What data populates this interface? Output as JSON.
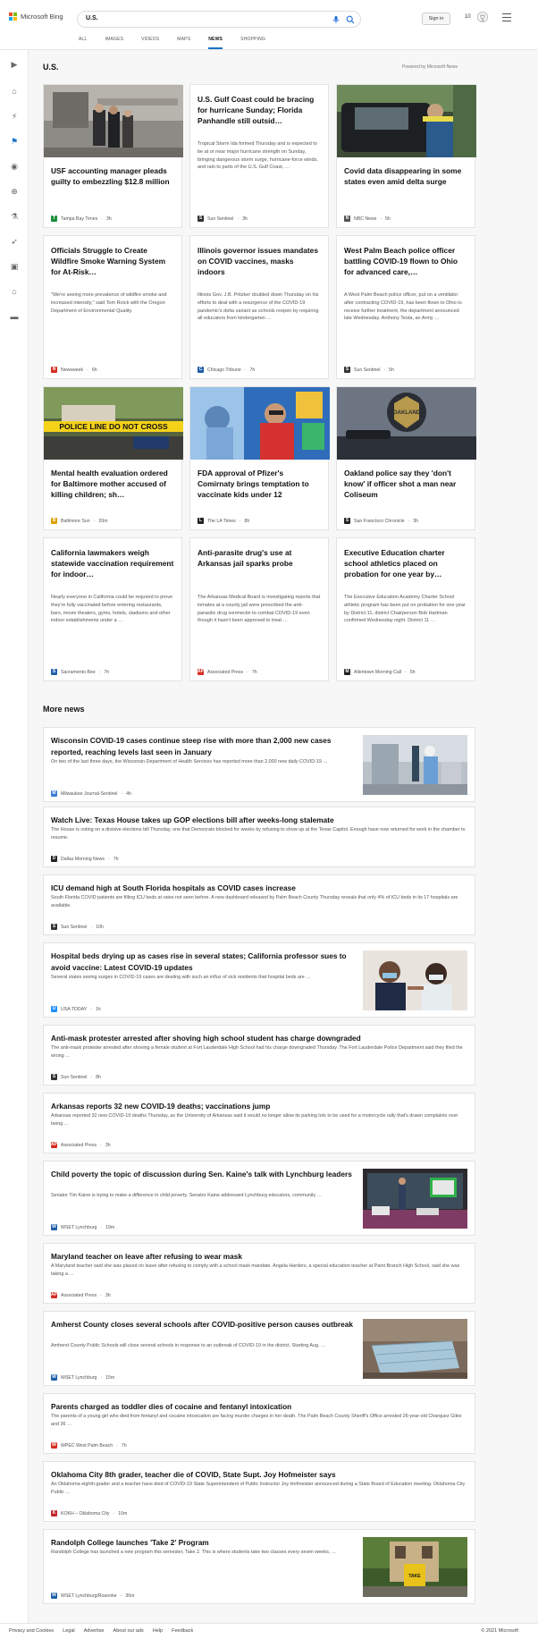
{
  "header": {
    "logo_text": "Microsoft Bing",
    "search_value": "U.S.",
    "sign_in": "Sign in",
    "points": "10",
    "tabs": [
      "ALL",
      "IMAGES",
      "VIDEOS",
      "MAPS",
      "NEWS",
      "SHOPPING"
    ],
    "active_tab": "NEWS"
  },
  "section": {
    "title": "U.S.",
    "powered_by": "Powered by Microsoft News"
  },
  "top_cards": [
    {
      "title": "USF accounting manager pleads guilty to embezzling $12.8 million",
      "snippet": "",
      "source": "Tampa Bay Times",
      "time": "3h",
      "badge": "T",
      "badge_color": "#1a8f3a",
      "has_image": true
    },
    {
      "title": "U.S. Gulf Coast could be bracing for hurricane Sunday; Florida Panhandle still outsid…",
      "snippet": "Tropical Storm Ida formed Thursday and is expected to be at or near major hurricane strength on Sunday, bringing dangerous storm surge, hurricane-force winds, and rain to parts of the U.S. Gulf Coast, …",
      "source": "Sun Sentinel",
      "time": "3h",
      "badge": "S",
      "badge_color": "#333333",
      "has_image": false
    },
    {
      "title": "Covid data disappearing in some states even amid delta surge",
      "snippet": "",
      "source": "NBC News",
      "time": "5h",
      "badge": "N",
      "badge_color": "#555555",
      "has_image": true
    },
    {
      "title": "Officials Struggle to Create Wildfire Smoke Warning System for At-Risk…",
      "snippet": "\"We're seeing more prevalence of wildfire smoke and increased intensity,\" said Tom Roick with the Oregon Department of Environmental Quality.",
      "source": "Newsweek",
      "time": "6h",
      "badge": "N",
      "badge_color": "#d62d20",
      "has_image": false
    },
    {
      "title": "Illinois governor issues mandates on COVID vaccines, masks indoors",
      "snippet": "Illinois Gov. J.B. Pritzker doubled down Thursday on his efforts to deal with a resurgence of the COVID-19 pandemic's delta variant as schools reopen by requiring all educators from kindergarten …",
      "source": "Chicago Tribune",
      "time": "7h",
      "badge": "C",
      "badge_color": "#1f5fa8",
      "has_image": false
    },
    {
      "title": "West Palm Beach police officer battling COVID-19 flown to Ohio for advanced care,…",
      "snippet": "A West Palm Beach police officer, put on a ventilator after contracting COVID-19, has been flown to Ohio to receive further treatment, the department announced late Wednesday. Anthony Testa, an Army …",
      "source": "Sun Sentinel",
      "time": "5h",
      "badge": "S",
      "badge_color": "#333333",
      "has_image": false
    },
    {
      "title": "Mental health evaluation ordered for Baltimore mother accused of killing children; sh…",
      "snippet": "",
      "source": "Baltimore Sun",
      "time": "20m",
      "badge": "B",
      "badge_color": "#e0a000",
      "has_image": true
    },
    {
      "title": "FDA approval of Pfizer's Comirnaty brings temptation to vaccinate kids under 12",
      "snippet": "",
      "source": "The LA Times",
      "time": "8h",
      "badge": "L",
      "badge_color": "#222222",
      "has_image": true
    },
    {
      "title": "Oakland police say they 'don't know' if officer shot a man near Coliseum",
      "snippet": "",
      "source": "San Francisco Chronicle",
      "time": "3h",
      "badge": "S",
      "badge_color": "#222222",
      "has_image": true
    },
    {
      "title": "California lawmakers weigh statewide vaccination requirement for indoor…",
      "snippet": "Nearly everyone in California could be required to prove they're fully vaccinated before entering restaurants, bars, movie theaters, gyms, hotels, stadiums and other indoor establishments under a …",
      "source": "Sacramento Bee",
      "time": "7h",
      "badge": "S",
      "badge_color": "#1f5fa8",
      "has_image": false
    },
    {
      "title": "Anti-parasite drug's use at Arkansas jail sparks probe",
      "snippet": "The Arkansas Medical Board is investigating reports that inmates at a county jail were prescribed the anti-parasitic drug ivermectin to combat COVID-19 even though it hasn't been approved to treat …",
      "source": "Associated Press",
      "time": "7h",
      "badge": "AP",
      "badge_color": "#d62d20",
      "has_image": false
    },
    {
      "title": "Executive Education charter school athletics placed on probation for one year by…",
      "snippet": "The Executive Education Academy Charter School athletic program has been put on probation for one year by District 11, district Chairperson Bob Hartman confirmed Wednesday night. District 11 …",
      "source": "Allentown Morning Call",
      "time": "5h",
      "badge": "M",
      "badge_color": "#222222",
      "has_image": false
    }
  ],
  "more_news": {
    "title": "More news",
    "items": [
      {
        "title": "Wisconsin COVID-19 cases continue steep rise with more than 2,000 new cases reported, reaching levels last seen in January",
        "snippet": "On two of the last three days, the Wisconsin Department of Health Services has reported more than 2,000 new daily COVID-19 …",
        "source": "Milwaukee Journal-Sentinel",
        "time": "4h",
        "badge": "M",
        "badge_color": "#3a7bd5",
        "has_thumb": true
      },
      {
        "title": "Watch Live: Texas House takes up GOP elections bill after weeks-long stalemate",
        "snippet": "The House is voting on a divisive elections bill Thursday, one that Democrats blocked for weeks by refusing to show up at the Texas Capitol. Enough have now returned for work in the chamber to resume.",
        "source": "Dallas Morning News",
        "time": "7h",
        "badge": "D",
        "badge_color": "#222222",
        "has_thumb": false
      },
      {
        "title": "ICU demand high at South Florida hospitals as COVID cases increase",
        "snippet": "South Florida COVID patients are filling ICU beds at rates not seen before. A new dashboard released by Palm Beach County Thursday reveals that only 4% of ICU beds in its 17 hospitals are available.",
        "source": "Sun Sentinel",
        "time": "10h",
        "badge": "S",
        "badge_color": "#333333",
        "has_thumb": false
      },
      {
        "title": "Hospital beds drying up as cases rise in several states; California professor sues to avoid vaccine: Latest COVID-19 updates",
        "snippet": "Several states seeing surges in COVID-19 cases are dealing with such an influx of sick residents that hospital beds are …",
        "source": "USA TODAY",
        "time": "1h",
        "badge": "U",
        "badge_color": "#1e90ff",
        "has_thumb": true
      },
      {
        "title": "Anti-mask protester arrested after shoving high school student has charge downgraded",
        "snippet": "The anti-mask protester arrested after shoving a female student at Fort Lauderdale High School had his charge downgraded Thursday. The Fort Lauderdale Police Department said they filed the wrong …",
        "source": "Sun Sentinel",
        "time": "8h",
        "badge": "S",
        "badge_color": "#333333",
        "has_thumb": false
      },
      {
        "title": "Arkansas reports 32 new COVID-19 deaths; vaccinations jump",
        "snippet": "Arkansas reported 32 new COVID-19 deaths Thursday, as the University of Arkansas said it would no longer allow its parking lots to be used for a motorcycle rally that's drawn complaints over being …",
        "source": "Associated Press",
        "time": "3h",
        "badge": "AP",
        "badge_color": "#d62d20",
        "has_thumb": false
      },
      {
        "title": "Child poverty the topic of discussion during Sen. Kaine's talk with Lynchburg leaders",
        "snippet": "Senator Tim Kaine is trying to make a difference in child poverty. Senator Kaine addressed Lynchburg educators, community …",
        "source": "WSET Lynchburg",
        "time": "19m",
        "badge": "W",
        "badge_color": "#1f5fa8",
        "has_thumb": true
      },
      {
        "title": "Maryland teacher on leave after refusing to wear mask",
        "snippet": "A Maryland teacher said she was placed on leave after refusing to comply with a school mask mandate. Angela Harders, a special education teacher at Paint Branch High School, said she was taking a …",
        "source": "Associated Press",
        "time": "3h",
        "badge": "AP",
        "badge_color": "#d62d20",
        "has_thumb": false
      },
      {
        "title": "Amherst County closes several schools after COVID-positive person causes outbreak",
        "snippet": "Amherst County Public Schools will close several schools in response to an outbreak of COVID-19 in the district. Starting Aug. …",
        "source": "WSET Lynchburg",
        "time": "15m",
        "badge": "W",
        "badge_color": "#1f5fa8",
        "has_thumb": true
      },
      {
        "title": "Parents charged as toddler dies of cocaine and fentanyl intoxication",
        "snippet": "The parents of a young girl who died from fentanyl and cocaine intoxication are facing murder charges in her death. The Palm Beach County Sheriff's Office arrested 26-year-old Charquez Giles and 36 …",
        "source": "WPEC West Palm Beach",
        "time": "7h",
        "badge": "W",
        "badge_color": "#d62d20",
        "has_thumb": false
      },
      {
        "title": "Oklahoma City 8th grader, teacher die of COVID, State Supt. Joy Hofmeister says",
        "snippet": "An Oklahoma eighth-grader and a teacher have died of COVID-19 State Superintendent of Public Instructor Joy Hofmeister announced during a State Board of Education meeting. Oklahoma City Public …",
        "source": "KOKH – Oklahoma City",
        "time": "10m",
        "badge": "K",
        "badge_color": "#c0282e",
        "has_thumb": false
      },
      {
        "title": "Randolph College launches 'Take 2' Program",
        "snippet": "Randolph College has launched a new program this semester, Take 2. This is where students take two classes every seven weeks, …",
        "source": "WSET Lynchburg/Roanoke",
        "time": "36m",
        "badge": "W",
        "badge_color": "#1f5fa8",
        "has_thumb": true
      }
    ]
  },
  "footer": {
    "links": [
      "Privacy and Cookies",
      "Legal",
      "Advertise",
      "About our ads",
      "Help",
      "Feedback"
    ],
    "copyright": "© 2021 Microsoft"
  }
}
